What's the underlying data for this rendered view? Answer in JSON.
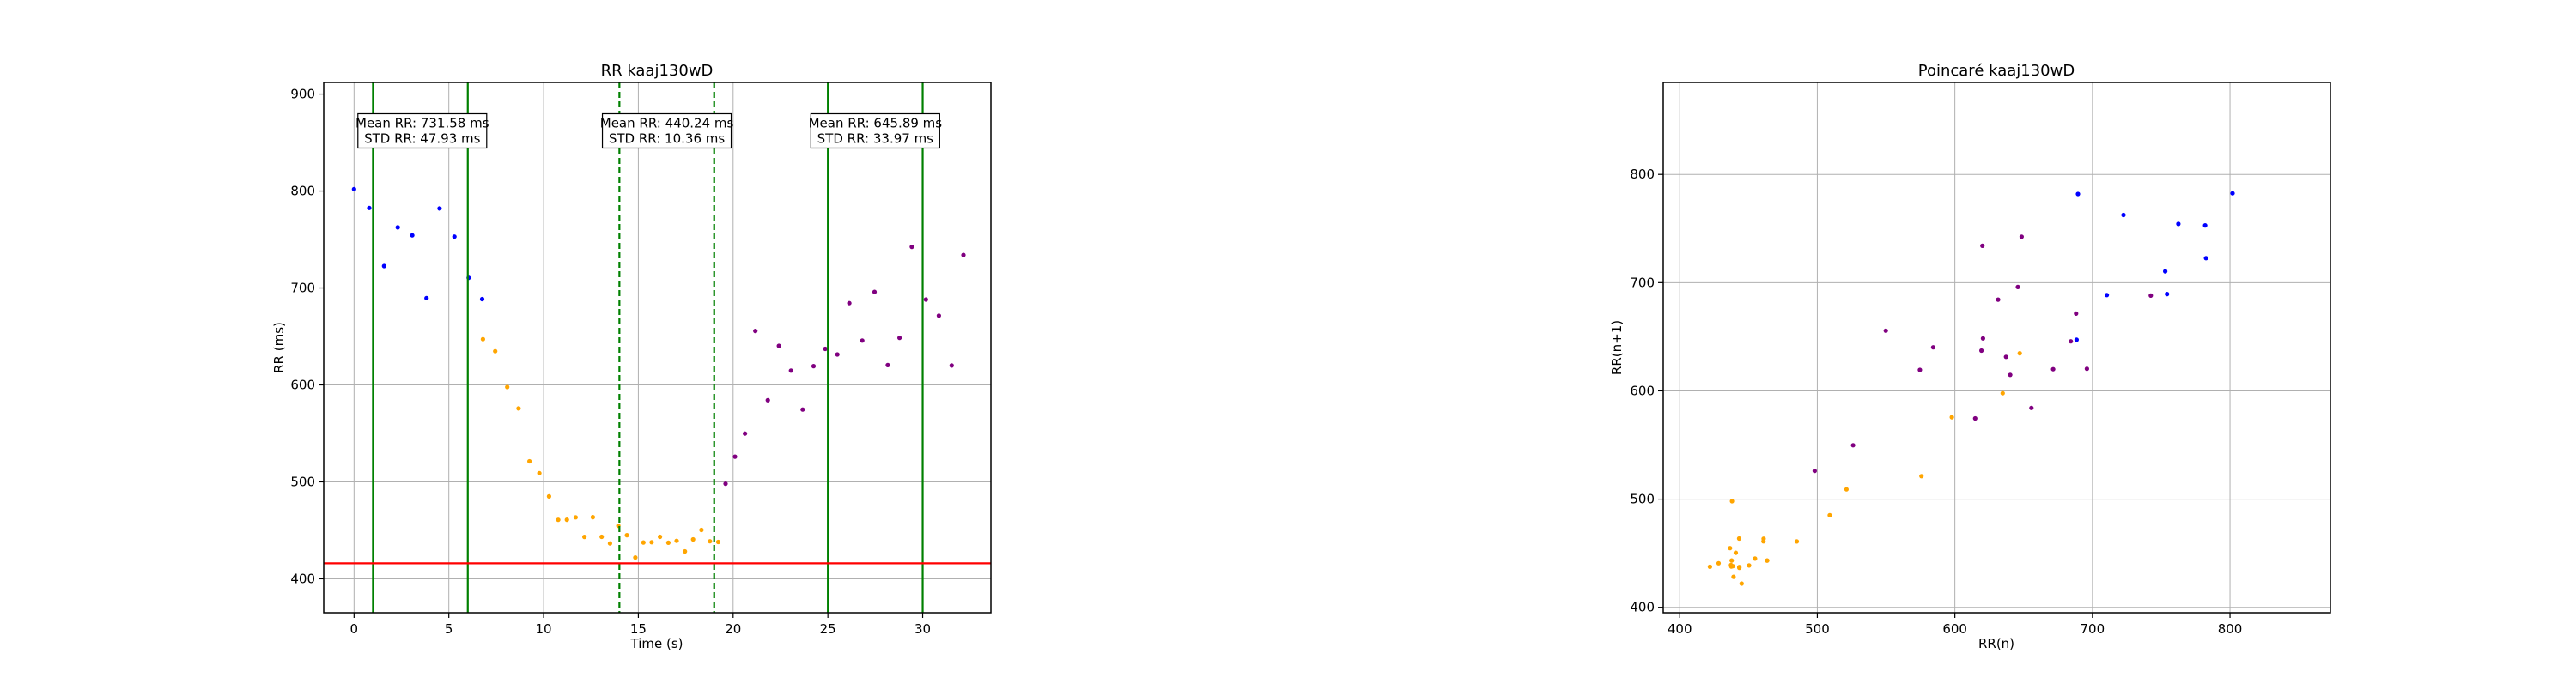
{
  "chart_data": [
    {
      "type": "scatter",
      "title": "RR kaaj130wD",
      "xlabel": "Time (s)",
      "ylabel": "RR (ms)",
      "xlim": [
        -1.6,
        33.6
      ],
      "ylim": [
        365,
        912
      ],
      "x_ticks": [
        0,
        5,
        10,
        15,
        20,
        25,
        30
      ],
      "y_ticks": [
        400,
        500,
        600,
        700,
        800,
        900
      ],
      "grid": true,
      "colors": {
        "segment_1": "#0000ff",
        "segment_2": "#ffa500",
        "segment_3": "#800080",
        "vline_solid": "#008000",
        "hline": "#ff0000"
      },
      "vlines_solid": [
        1,
        6,
        25,
        30
      ],
      "vlines_dashed": [
        14,
        19
      ],
      "hline": 416,
      "segments": [
        {
          "x_range": [
            0,
            7
          ],
          "noise": 48,
          "knots": [
            [
              0,
              738
            ],
            [
              3,
              735
            ],
            [
              6,
              730
            ],
            [
              6.8,
              715
            ]
          ]
        },
        {
          "x_range": [
            6.8,
            19.6
          ],
          "noise": 10,
          "knots": [
            [
              6.8,
              690
            ],
            [
              7.5,
              620
            ],
            [
              8.5,
              590
            ],
            [
              9.3,
              510
            ],
            [
              10.5,
              470
            ],
            [
              12,
              450
            ],
            [
              14,
              445
            ],
            [
              16,
              438
            ],
            [
              19.5,
              440
            ]
          ]
        },
        {
          "x_range": [
            19.6,
            32.2
          ],
          "noise": 34,
          "knots": [
            [
              19.6,
              440
            ],
            [
              20,
              470
            ],
            [
              20.5,
              540
            ],
            [
              21.2,
              600
            ],
            [
              23,
              620
            ],
            [
              25,
              635
            ],
            [
              28,
              660
            ],
            [
              32.2,
              660
            ]
          ]
        }
      ],
      "annotations": [
        {
          "line1": "Mean RR: 731.58 ms",
          "line2": "STD RR: 47.93 ms",
          "x": 3.6,
          "y": 862
        },
        {
          "line1": "Mean RR: 440.24 ms",
          "line2": "STD RR: 10.36 ms",
          "x": 16.5,
          "y": 862
        },
        {
          "line1": "Mean RR: 645.89 ms",
          "line2": "STD RR: 33.97 ms",
          "x": 27.5,
          "y": 862
        }
      ]
    },
    {
      "type": "scatter",
      "title": "Poincaré kaaj130wD",
      "xlabel": "RR(n)",
      "ylabel": "RR(n+1)",
      "xlim": [
        388,
        873
      ],
      "ylim": [
        395,
        885
      ],
      "x_ticks": [
        400,
        500,
        600,
        700,
        800
      ],
      "y_ticks": [
        400,
        500,
        600,
        700,
        800
      ],
      "grid": true,
      "colors": {
        "segment_1": "#0000ff",
        "segment_2": "#ffa500",
        "segment_3": "#800080"
      }
    }
  ]
}
